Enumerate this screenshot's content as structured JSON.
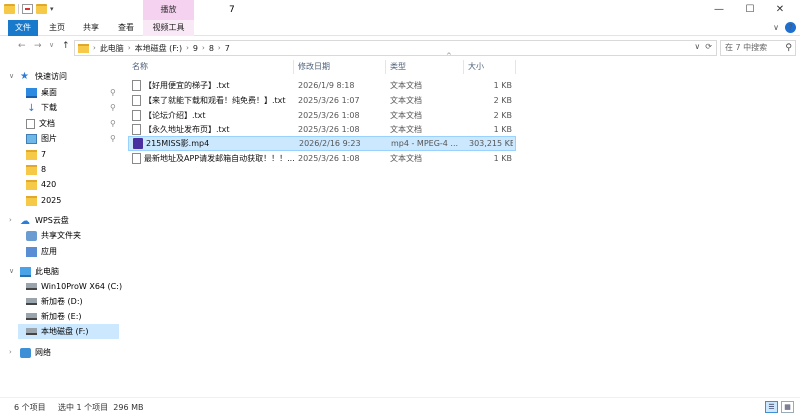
{
  "window": {
    "title": "7",
    "context_tab": "播放",
    "minimize": "—",
    "maximize": "☐",
    "close": "✕"
  },
  "ribbon": {
    "tabs": [
      "文件",
      "主页",
      "共享",
      "查看",
      "视频工具"
    ],
    "expand": "∨",
    "help": "?"
  },
  "nav": {
    "back": "←",
    "forward": "→",
    "recent": "∨",
    "up": "↑",
    "breadcrumb": [
      "此电脑",
      "本地磁盘 (F:)",
      "9",
      "8",
      "7"
    ],
    "addr_dropdown": "∨",
    "refresh": "⟳",
    "search_placeholder": "在 7 中搜索"
  },
  "sidebar": {
    "quick_access": "快速访问",
    "items": [
      {
        "label": "桌面",
        "icon": "desktop-icon",
        "pinned": true
      },
      {
        "label": "下载",
        "icon": "download-icon",
        "pinned": true
      },
      {
        "label": "文档",
        "icon": "document-icon",
        "pinned": true
      },
      {
        "label": "图片",
        "icon": "picture-icon",
        "pinned": true
      },
      {
        "label": "7",
        "icon": "folder-icon"
      },
      {
        "label": "8",
        "icon": "folder-icon"
      },
      {
        "label": "420",
        "icon": "folder-icon"
      },
      {
        "label": "2025",
        "icon": "folder-icon"
      }
    ],
    "wps": "WPS云盘",
    "wps_items": [
      "共享文件夹",
      "应用"
    ],
    "this_pc": "此电脑",
    "drives": [
      "Win10ProW X64 (C:)",
      "新加卷 (D:)",
      "新加卷 (E:)",
      "本地磁盘 (F:)"
    ],
    "network": "网络",
    "pin_glyph": "📌"
  },
  "columns": [
    "名称",
    "修改日期",
    "类型",
    "大小"
  ],
  "files": [
    {
      "name": "【好用便宜的梯子】.txt",
      "date": "2026/1/9 8:18",
      "type": "文本文档",
      "size": "1 KB",
      "icon": "text-file-icon"
    },
    {
      "name": "【来了就能下载和观看！纯免费！】.txt",
      "date": "2025/3/26 1:07",
      "type": "文本文档",
      "size": "2 KB",
      "icon": "text-file-icon"
    },
    {
      "name": "【论坛介绍】.txt",
      "date": "2025/3/26 1:08",
      "type": "文本文档",
      "size": "2 KB",
      "icon": "text-file-icon"
    },
    {
      "name": "【永久地址发布页】.txt",
      "date": "2025/3/26 1:08",
      "type": "文本文档",
      "size": "1 KB",
      "icon": "text-file-icon"
    },
    {
      "name": "215MISS影.mp4",
      "date": "2026/2/16 9:23",
      "type": "mp4 - MPEG-4 ...",
      "size": "303,215 KB",
      "icon": "video-file-icon",
      "selected": true
    },
    {
      "name": "最新地址及APP请发邮箱自动获取！！！...",
      "date": "2025/3/26 1:08",
      "type": "文本文档",
      "size": "1 KB",
      "icon": "text-file-icon"
    }
  ],
  "status": {
    "count": "6 个项目",
    "selection": "选中 1 个项目  296 MB"
  }
}
